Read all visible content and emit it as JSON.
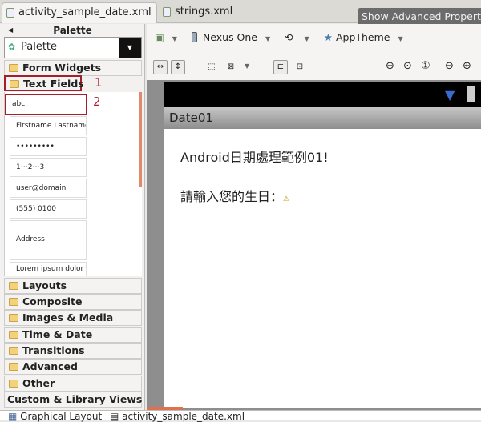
{
  "tabs": [
    {
      "label": "activity_sample_date.xml",
      "active": true
    },
    {
      "label": "strings.xml",
      "active": false
    }
  ],
  "tooltip": "Show Advanced Properties",
  "palette": {
    "title": "Palette",
    "dropdown_value": "Palette",
    "categories_top": [
      "Form Widgets",
      "Text Fields"
    ],
    "text_fields": [
      "abc",
      "Firstname Lastname",
      "•••••••••",
      "1⋯2⋯3",
      "user@domain",
      "(555) 0100",
      "Address",
      "Lorem ipsum dolor sit"
    ],
    "categories_bottom": [
      "Layouts",
      "Composite",
      "Images & Media",
      "Time & Date",
      "Transitions",
      "Advanced",
      "Other"
    ],
    "custom": "Custom & Library Views"
  },
  "annotations": [
    "1",
    "2"
  ],
  "toolbar": {
    "device": "Nexus One",
    "theme": "AppTheme"
  },
  "device": {
    "app_title": "Date01",
    "text1": "Android日期處理範例01!",
    "text2": "請輸入您的生日："
  },
  "bottom_tabs": [
    "Graphical Layout",
    "activity_sample_date.xml"
  ],
  "colors": {
    "annotation": "#a3202a",
    "folder": "#f3d27a",
    "status_bar": "#000000"
  }
}
